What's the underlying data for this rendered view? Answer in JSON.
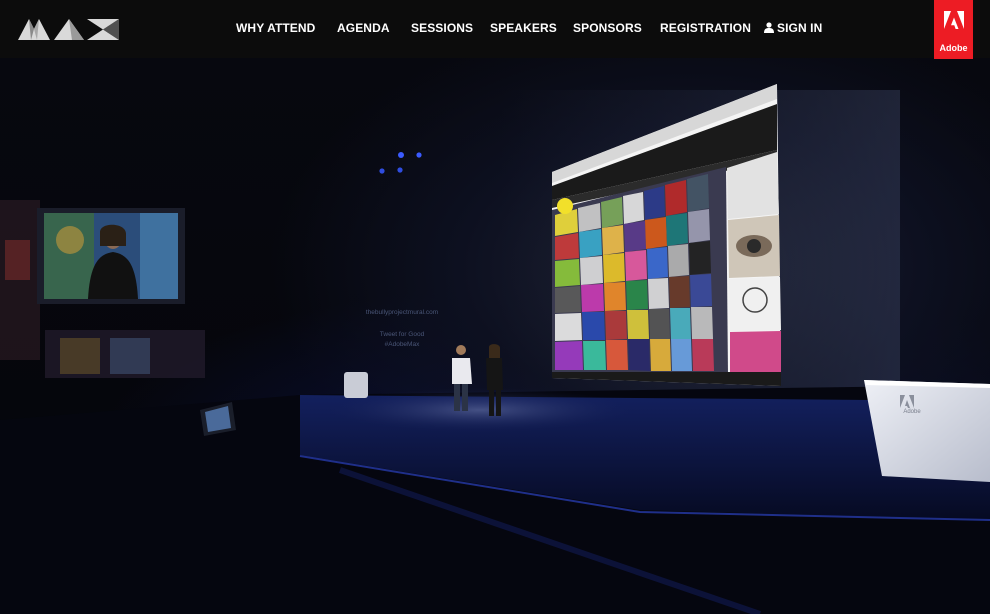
{
  "header": {
    "logo_name": "MAX",
    "nav": [
      {
        "label": "WHY ATTEND"
      },
      {
        "label": "AGENDA"
      },
      {
        "label": "SESSIONS"
      },
      {
        "label": "SPEAKERS"
      },
      {
        "label": "SPONSORS"
      },
      {
        "label": "REGISTRATION"
      },
      {
        "label": "SIGN IN"
      }
    ],
    "adobe_label": "Adobe",
    "colors": {
      "bar": "#0c0c0c",
      "adobe_red": "#ed1c24",
      "nav_text": "#ffffff"
    }
  },
  "hero": {
    "stage_url": "thebullyprojectmural.com",
    "stage_tweet": "Tweet for Good",
    "stage_hashtag": "#AdobeMax",
    "podium_label": "Adobe"
  }
}
